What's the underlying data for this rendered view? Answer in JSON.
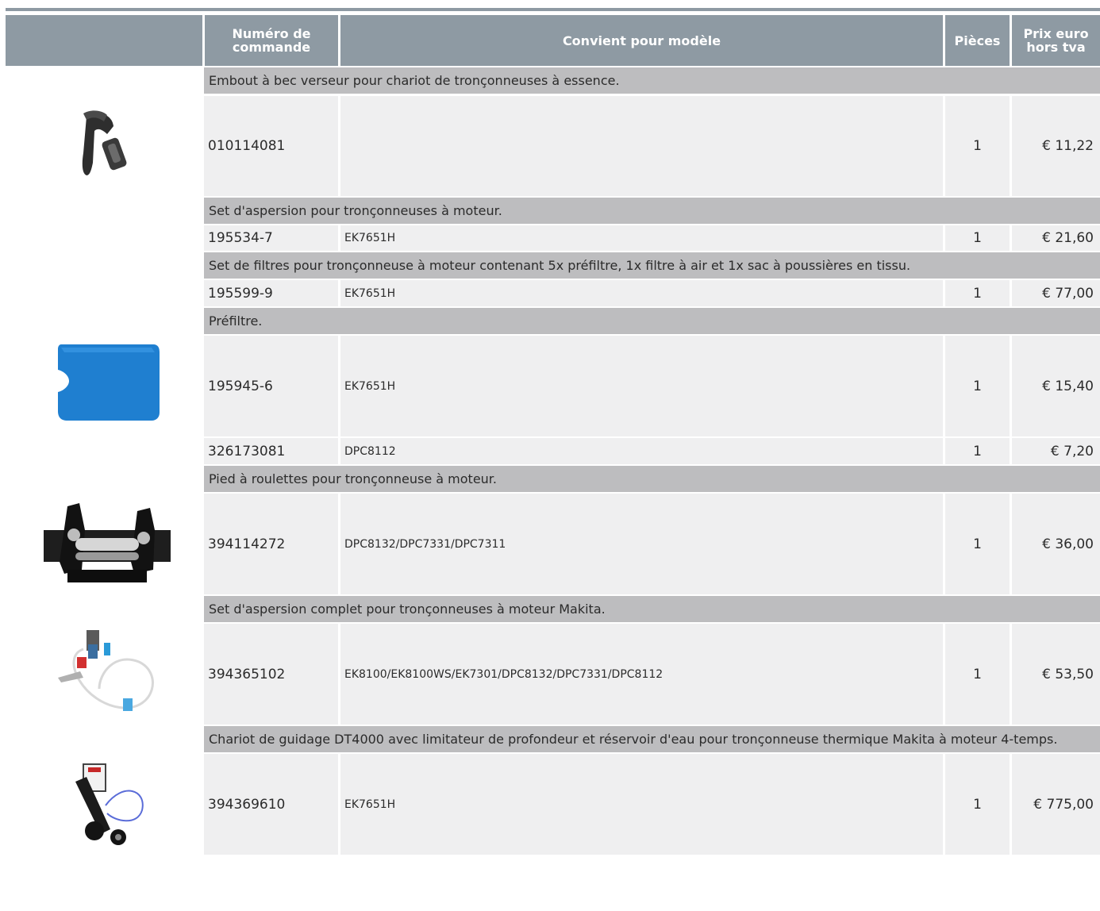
{
  "header": {
    "col_number": "Numéro de commande",
    "col_model": "Convient pour modèle",
    "col_qty": "Pièces",
    "col_price": "Prix euro hors tva"
  },
  "groups": [
    {
      "description": "Embout à bec verseur pour chariot de tronçonneuses à essence.",
      "rows": [
        {
          "number": "010114081",
          "model": "",
          "qty": "1",
          "price": "€ 11,22"
        }
      ]
    },
    {
      "description": "Set d'aspersion pour tronçonneuses à moteur.",
      "rows": [
        {
          "number": "195534-7",
          "model": "EK7651H",
          "qty": "1",
          "price": "€ 21,60"
        }
      ]
    },
    {
      "description": "Set de filtres pour tronçonneuse à moteur contenant 5x préfiltre, 1x filtre à air et 1x sac à poussières en tissu.",
      "rows": [
        {
          "number": "195599-9",
          "model": "EK7651H",
          "qty": "1",
          "price": "€ 77,00"
        }
      ]
    },
    {
      "description": "Préfiltre.",
      "rows": [
        {
          "number": "195945-6",
          "model": "EK7651H",
          "qty": "1",
          "price": "€ 15,40"
        },
        {
          "number": "326173081",
          "model": "DPC8112",
          "qty": "1",
          "price": "€ 7,20"
        }
      ]
    },
    {
      "description": "Pied à roulettes pour tronçonneuse à moteur.",
      "rows": [
        {
          "number": "394114272",
          "model": "DPC8132/DPC7331/DPC7311",
          "qty": "1",
          "price": "€ 36,00"
        }
      ]
    },
    {
      "description": "Set d'aspersion complet pour tronçonneuses à moteur Makita.",
      "rows": [
        {
          "number": "394365102",
          "model": "EK8100/EK8100WS/EK7301/DPC8132/DPC7331/DPC8112",
          "qty": "1",
          "price": "€ 53,50"
        }
      ]
    },
    {
      "description": "Chariot de guidage DT4000 avec limitateur de profondeur et réservoir d'eau pour tronçonneuse thermique Makita à moteur 4-temps.",
      "rows": [
        {
          "number": "394369610",
          "model": "EK7651H",
          "qty": "1",
          "price": "€ 775,00"
        }
      ]
    }
  ],
  "colors": {
    "header_bg": "#8e9aa3",
    "description_bg": "#bdbdbf",
    "row_bg": "#efeff0",
    "filter_blue": "#1f7fd0"
  },
  "images": [
    "spout-image",
    "prefilter-image",
    "roller-stand-image",
    "sprinkler-set-image",
    "guide-cart-image"
  ]
}
